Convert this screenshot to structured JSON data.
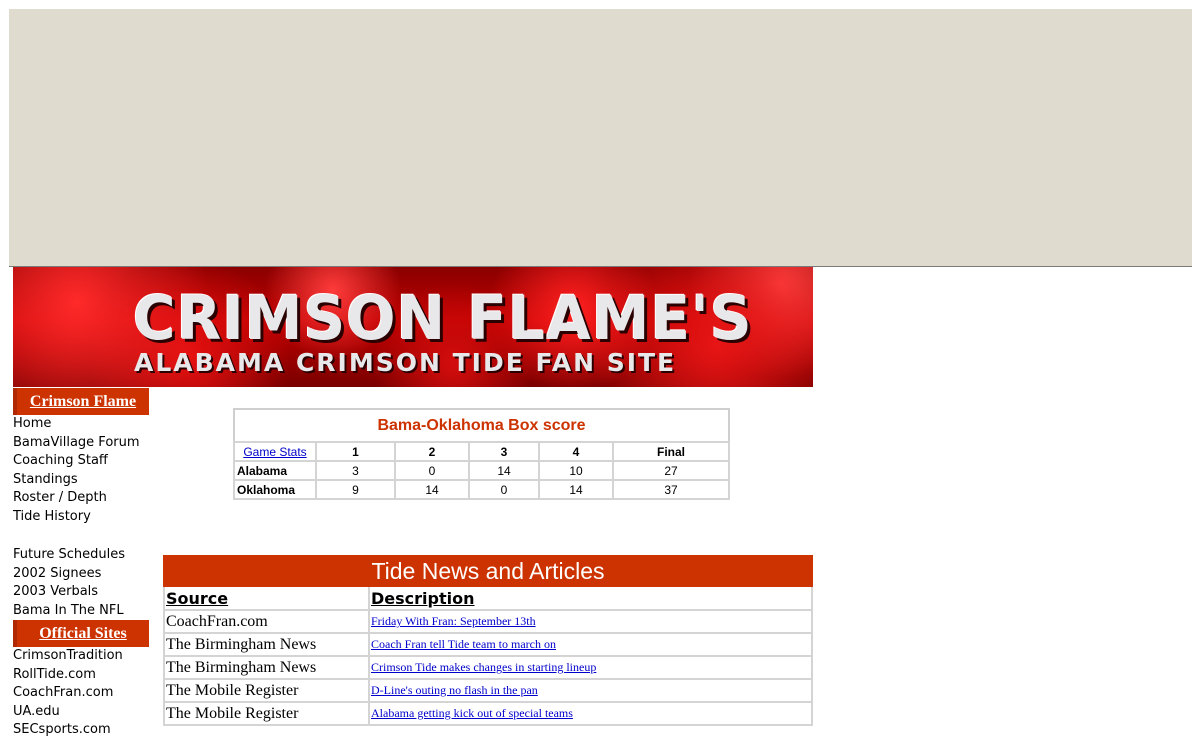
{
  "banner": {
    "title": "CRIMSON FLAME'S",
    "subtitle": "ALABAMA CRIMSON TIDE FAN SITE"
  },
  "sidebar": {
    "site_heading": "Crimson Flame",
    "site_links": [
      "Home",
      "BamaVillage Forum",
      "Coaching Staff",
      "Standings",
      "Roster / Depth",
      "Tide History"
    ],
    "extra_links": [
      "Future Schedules",
      "2002 Signees",
      "2003 Verbals",
      "Bama In The NFL"
    ],
    "official_heading": "Official Sites",
    "official_links": [
      "CrimsonTradition",
      "RollTide.com",
      "CoachFran.com",
      "UA.edu",
      "SECsports.com"
    ]
  },
  "boxscore": {
    "title": "Bama-Oklahoma Box score",
    "stats_link": "Game Stats",
    "headers": [
      "1",
      "2",
      "3",
      "4",
      "Final"
    ],
    "rows": [
      {
        "team": "Alabama",
        "scores": [
          "3",
          "0",
          "14",
          "10",
          "27"
        ]
      },
      {
        "team": "Oklahoma",
        "scores": [
          "9",
          "14",
          "0",
          "14",
          "37"
        ]
      }
    ]
  },
  "news": {
    "title": "Tide News and Articles",
    "col_source": "Source",
    "col_description": "Description",
    "items": [
      {
        "source": "CoachFran.com",
        "description": "Friday With Fran: September 13th"
      },
      {
        "source": "The Birmingham News",
        "description": "Coach Fran tell Tide team to march on"
      },
      {
        "source": "The Birmingham News",
        "description": "Crimson Tide makes changes in starting lineup"
      },
      {
        "source": "The Mobile Register",
        "description": "D-Line's outing no flash in the pan"
      },
      {
        "source": "The Mobile Register",
        "description": "Alabama getting kick out of special teams"
      }
    ]
  }
}
